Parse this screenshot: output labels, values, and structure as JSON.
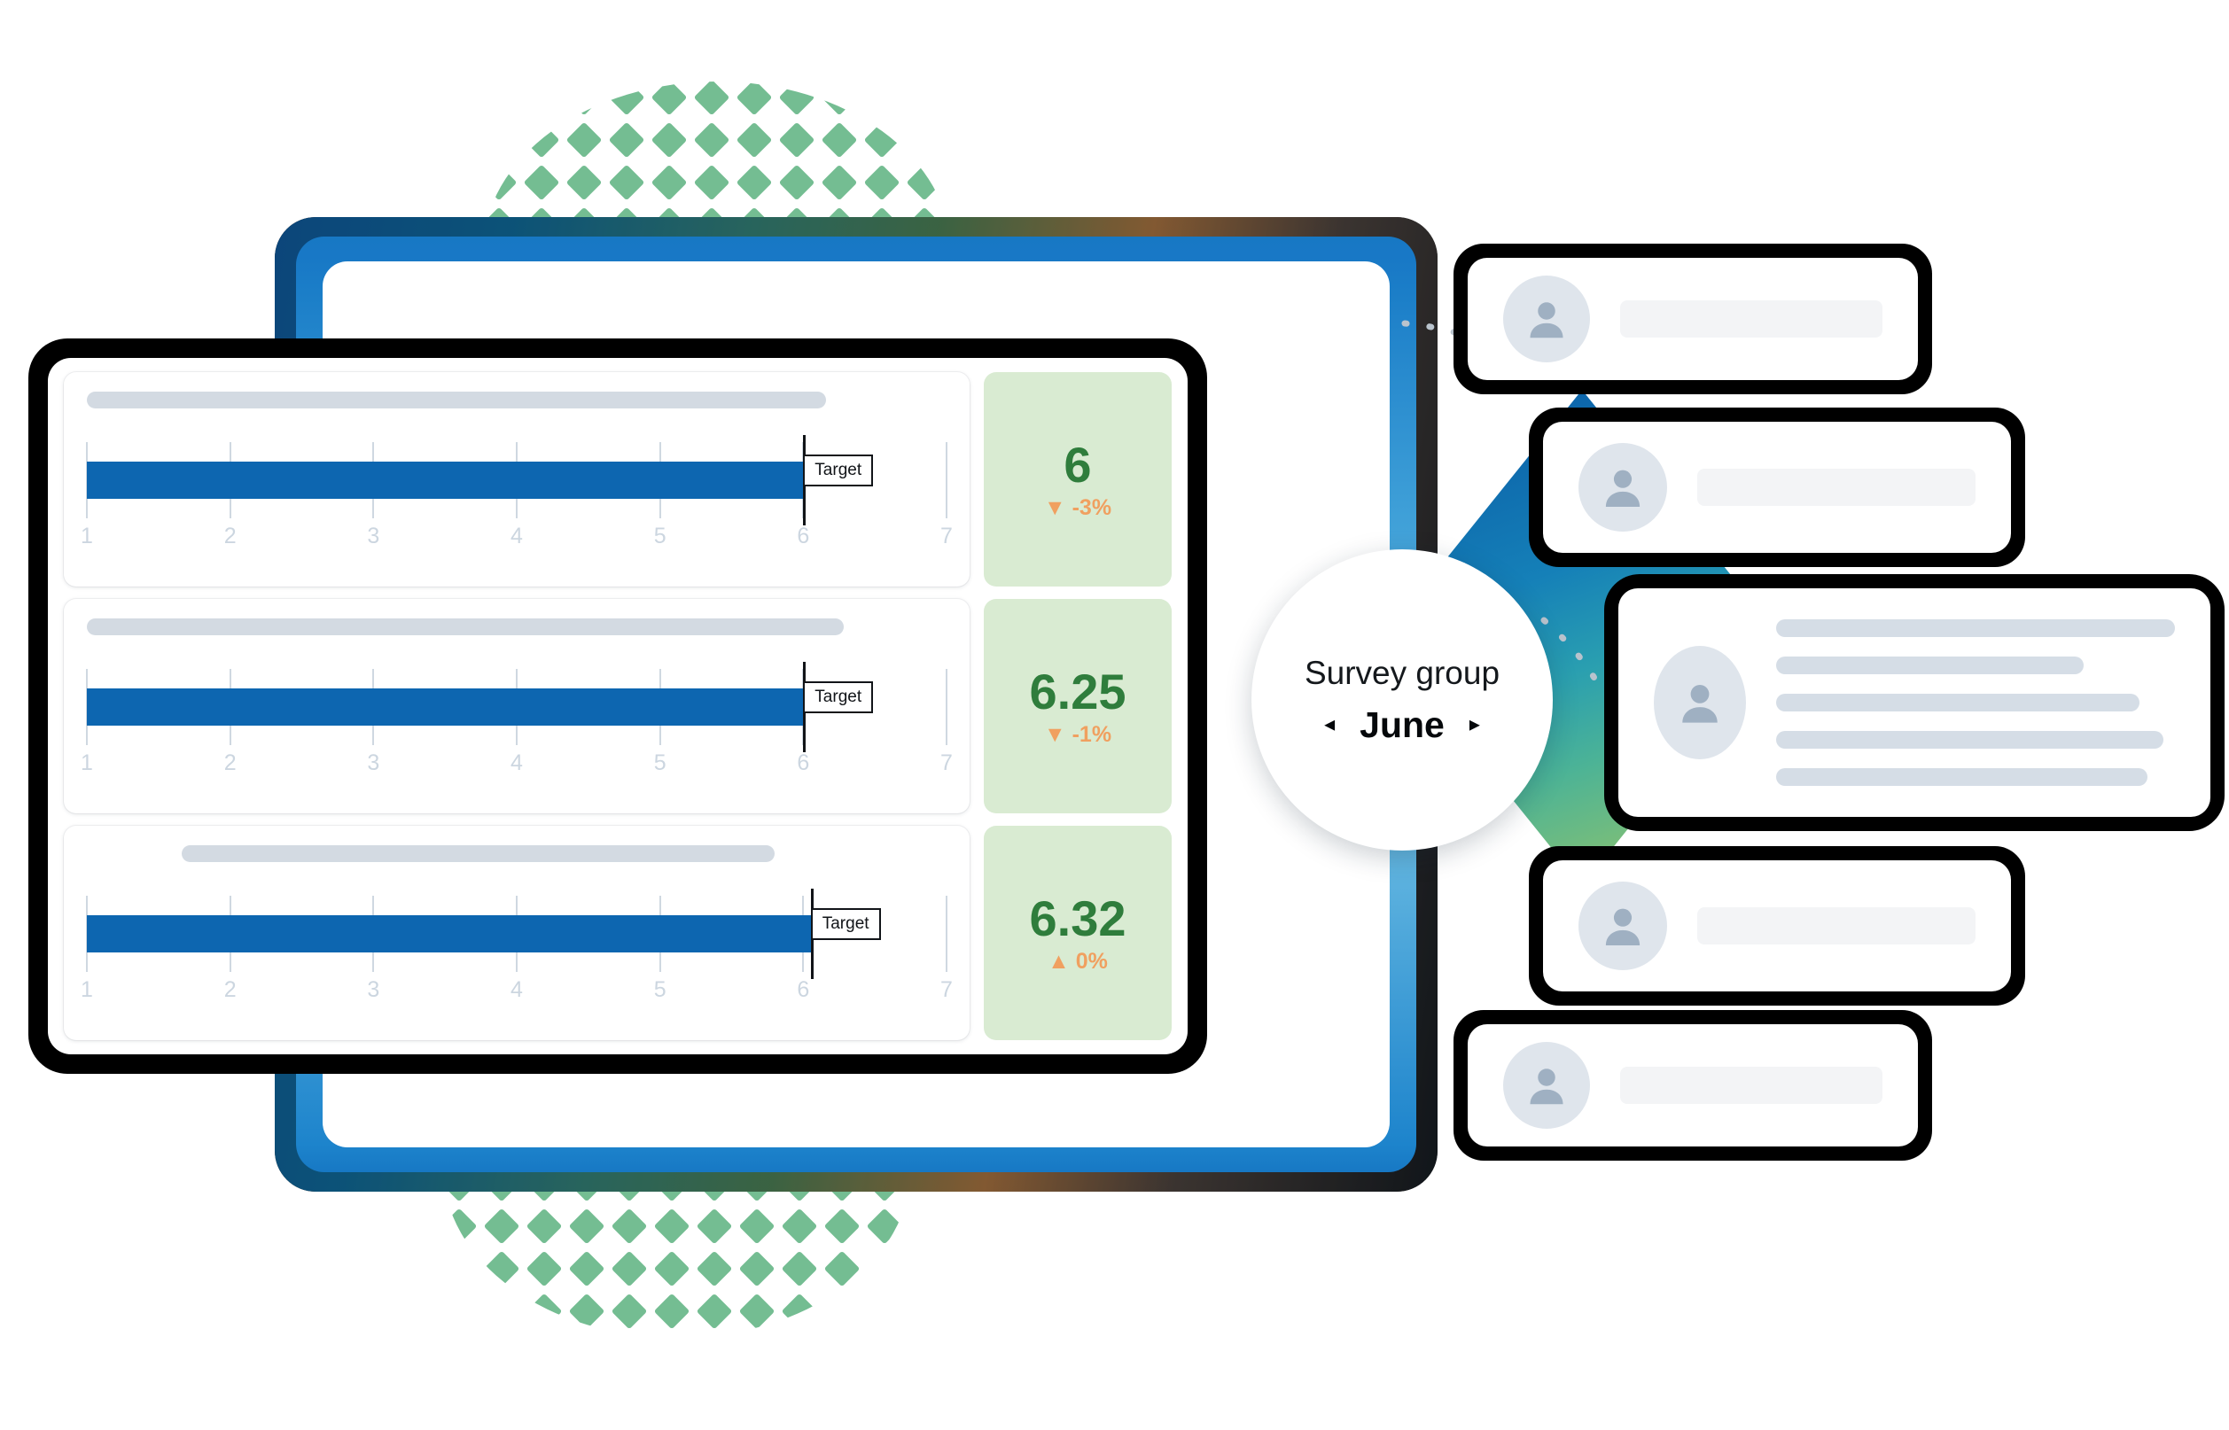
{
  "colors": {
    "bar_blue": "#0d66b0",
    "kpi_bg": "#d9ebd2",
    "kpi_value_green": "#2f7d3c",
    "kpi_delta_orange": "#f0a060",
    "axis_label": "#ccd6e0",
    "skeleton": "#d3dae2",
    "avatar_bg": "#dfe5ec",
    "diamond_green": "#74bd92",
    "frame_black": "#000000"
  },
  "survey_widget": {
    "title": "Survey group",
    "period": "June",
    "prev_arrow": "◂",
    "next_arrow": "▸"
  },
  "chart_data": {
    "type": "bar",
    "title": "",
    "xlabel": "",
    "ylabel": "",
    "xlim": [
      1,
      7
    ],
    "tick_labels": [
      "1",
      "2",
      "3",
      "4",
      "5",
      "6",
      "7"
    ],
    "grid": false,
    "legend": "none",
    "target_label": "Target",
    "series": [
      {
        "name": "row-1",
        "value": 6.0,
        "target": 6.0,
        "score_label": "6",
        "delta_label": "-3%",
        "delta_arrow": "▼",
        "delta_direction": "down"
      },
      {
        "name": "row-2",
        "value": 6.25,
        "target": 6.0,
        "score_label": "6.25",
        "delta_label": "-1%",
        "delta_arrow": "▼",
        "delta_direction": "down"
      },
      {
        "name": "row-3",
        "value": 6.32,
        "target": 6.05,
        "score_label": "6.32",
        "delta_label": "0%",
        "delta_arrow": "▲",
        "delta_direction": "up"
      }
    ]
  },
  "bullet_rows": [
    {
      "title_width_pct": 86,
      "title_offset_pct": 0,
      "bar_end_value": 6.0,
      "target_value": 6.0
    },
    {
      "title_width_pct": 88,
      "title_offset_pct": 0,
      "bar_end_value": 6.25,
      "target_value": 6.0
    },
    {
      "title_width_pct": 69,
      "title_offset_pct": 11,
      "bar_end_value": 6.32,
      "target_value": 6.05
    }
  ],
  "placeholder_cards": [
    {
      "name": "comment-card-1",
      "avatar": "user-avatar-icon",
      "lines": [
        100
      ]
    },
    {
      "name": "comment-card-2",
      "avatar": "user-avatar-icon",
      "lines": [
        100
      ]
    },
    {
      "name": "comment-card-3",
      "avatar": "user-avatar-icon",
      "lines": [
        100,
        77,
        91,
        97,
        93
      ]
    },
    {
      "name": "comment-card-4",
      "avatar": "user-avatar-icon",
      "lines": [
        100
      ]
    },
    {
      "name": "comment-card-5",
      "avatar": "user-avatar-icon",
      "lines": [
        100
      ]
    }
  ],
  "decorations": {
    "top_dots": "green-diamond-cluster",
    "bottom_dots": "green-diamond-cluster",
    "rhombus": "gradient-rhombus",
    "connector": "dotted-connector-line"
  }
}
